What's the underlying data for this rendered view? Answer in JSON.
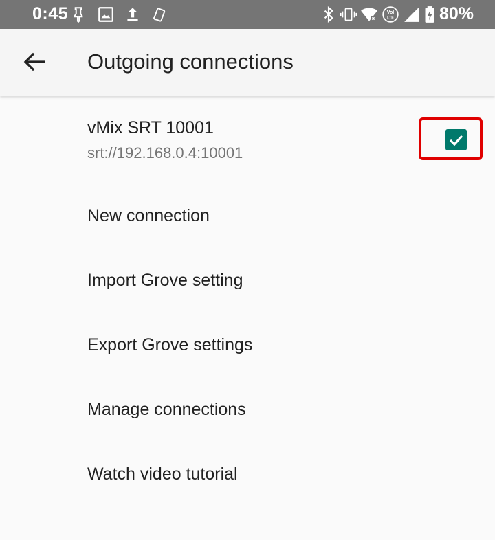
{
  "status_bar": {
    "time": "0:45",
    "battery": "80%",
    "left_icons": [
      "pin-icon",
      "image-icon",
      "upload-icon",
      "rotate-icon"
    ],
    "right_icons": [
      "bluetooth-icon",
      "vibrate-icon",
      "wifi-icon",
      "volte-icon",
      "signal-icon",
      "battery-icon"
    ],
    "background": "#757575"
  },
  "app_bar": {
    "title": "Outgoing connections",
    "back_icon": "arrow-back-icon"
  },
  "connection": {
    "name": "vMix SRT 10001",
    "url": "srt://192.168.0.4:10001",
    "checked": true,
    "checkbox_color": "#00796b",
    "highlight_color": "#e00000"
  },
  "menu": {
    "items": [
      {
        "label": "New connection"
      },
      {
        "label": "Import Grove setting"
      },
      {
        "label": "Export Grove settings"
      },
      {
        "label": "Manage connections"
      },
      {
        "label": "Watch video tutorial"
      }
    ]
  }
}
